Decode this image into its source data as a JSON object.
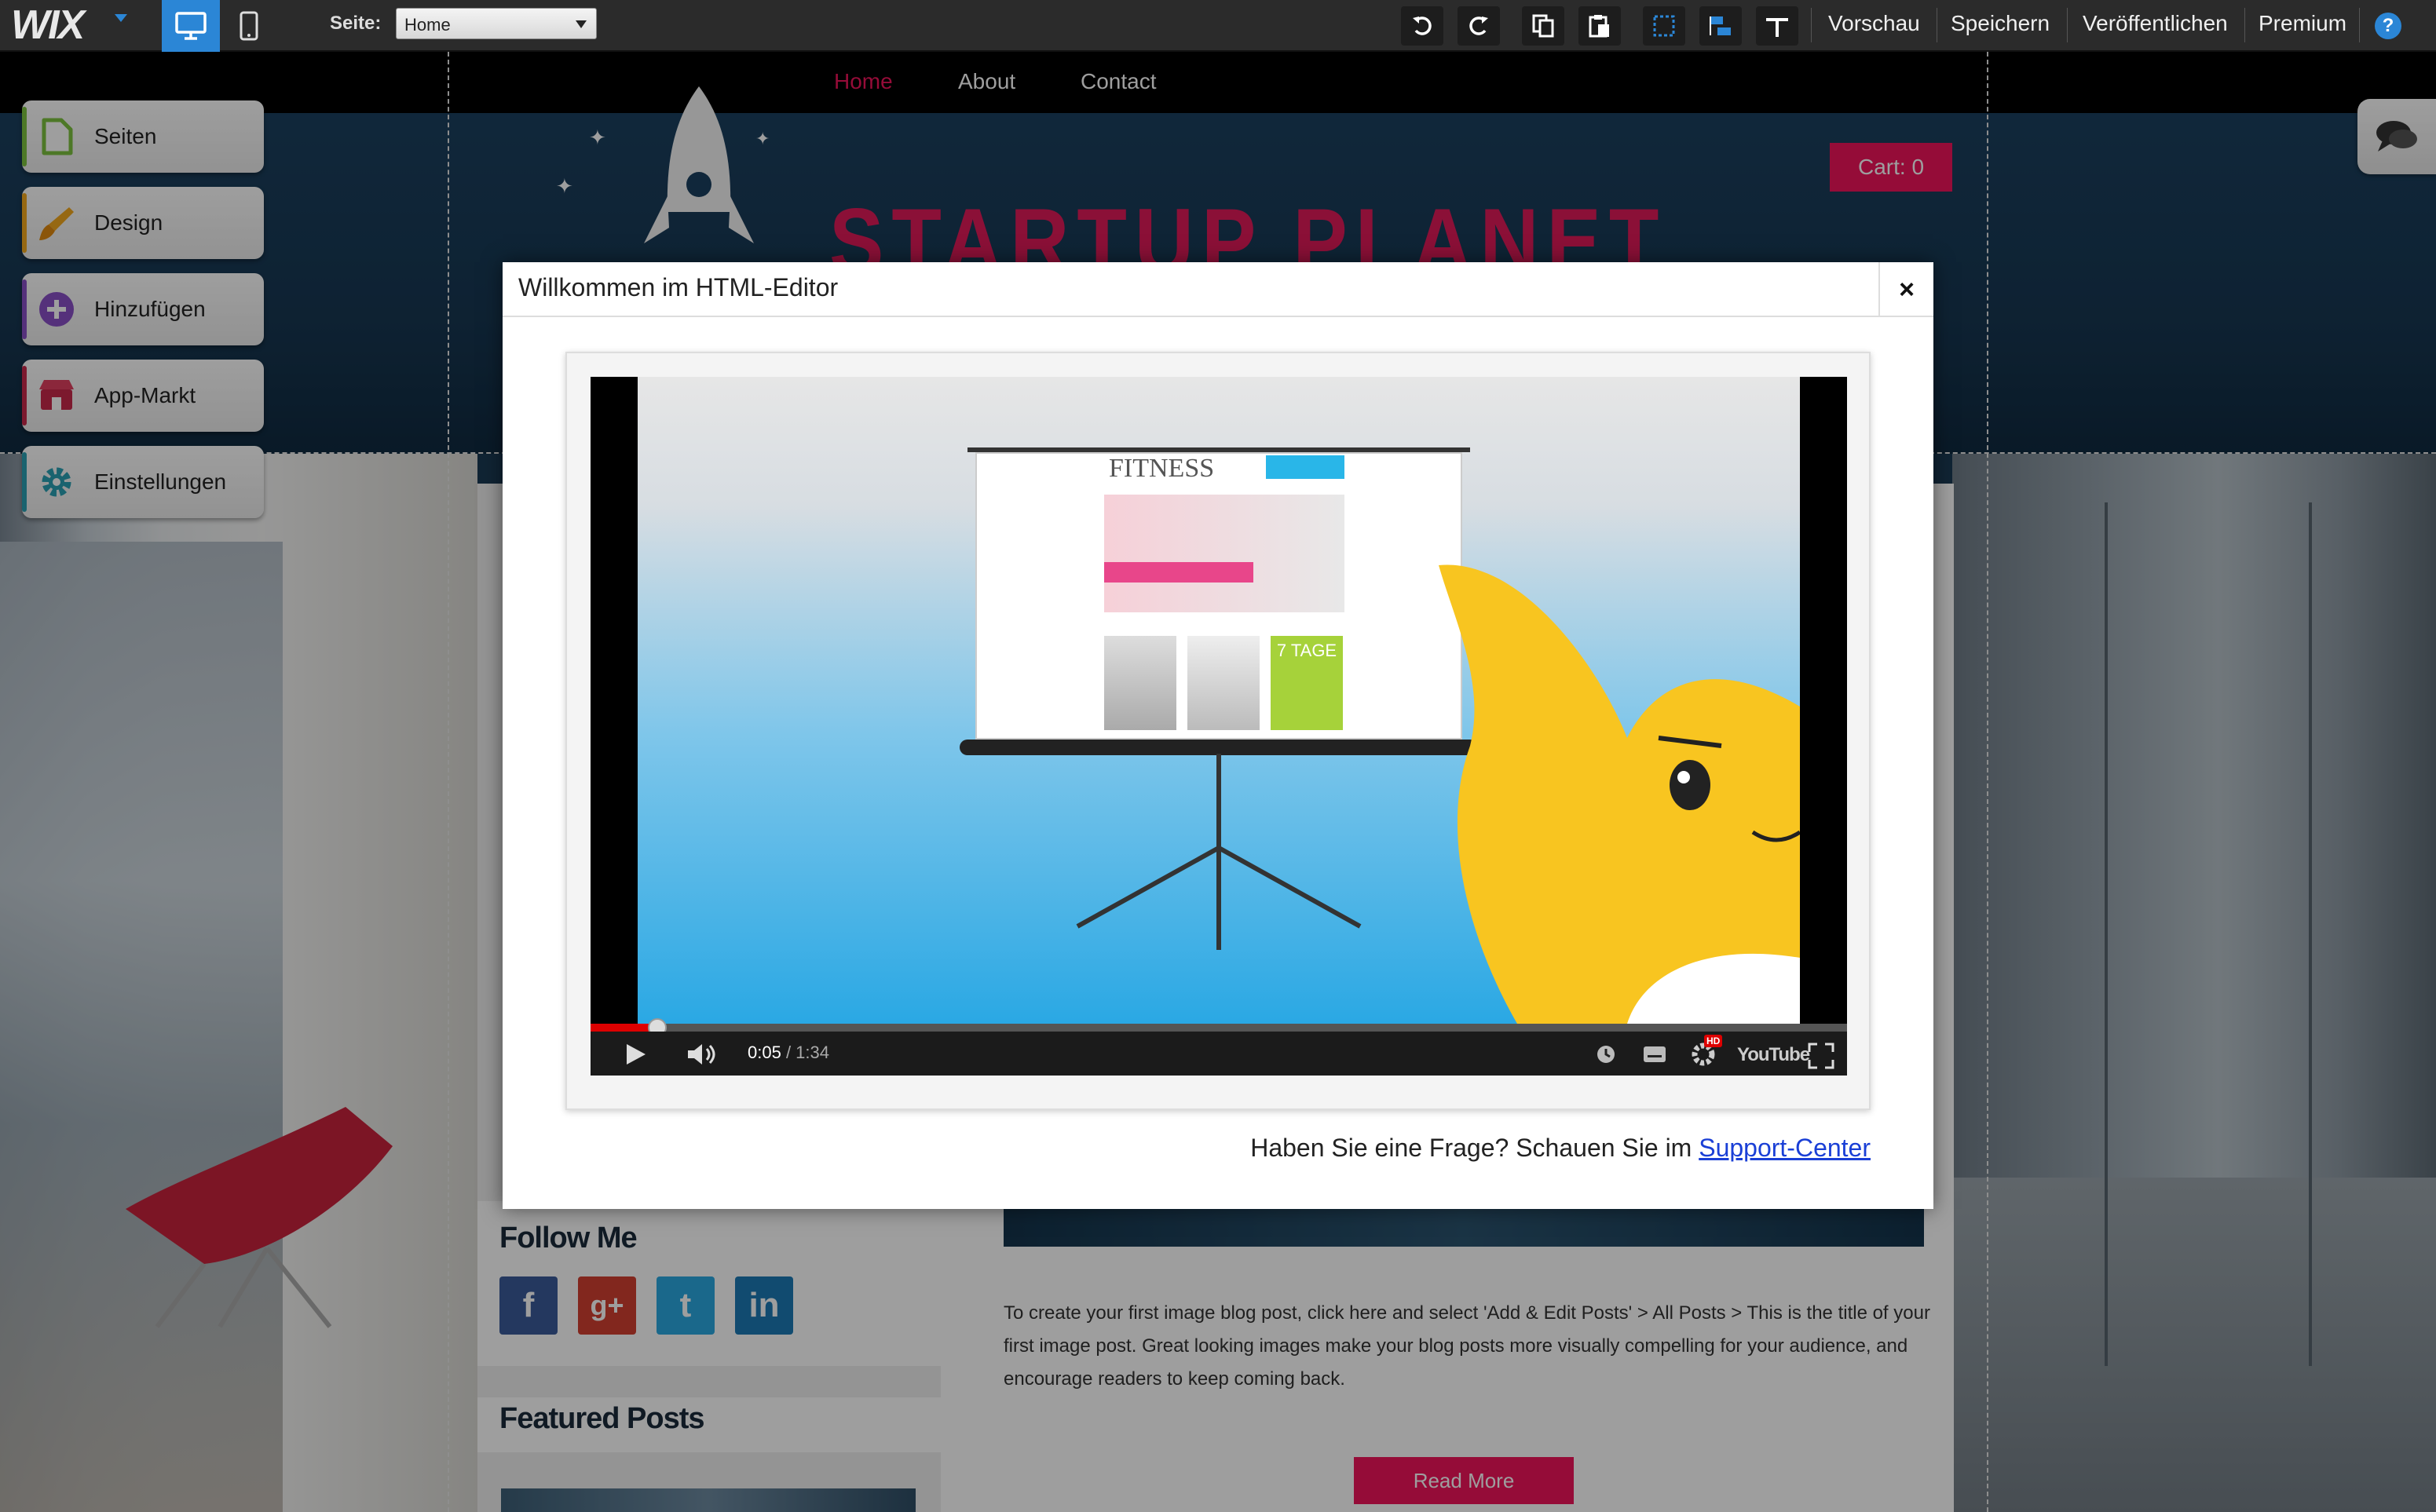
{
  "toolbar": {
    "logo": "WIX",
    "page_label": "Seite:",
    "page_value": "Home",
    "menu": [
      "Vorschau",
      "Speichern",
      "Veröffentlichen",
      "Premium"
    ],
    "help": "?"
  },
  "site": {
    "nav": [
      "Home",
      "About",
      "Contact"
    ],
    "title": "STARTUP PLANET",
    "cart": "Cart: 0",
    "follow_title": "Follow Me",
    "social": [
      "f",
      "g+",
      "t",
      "in"
    ],
    "featured_title": "Featured Posts",
    "post_text": "To create your first image blog post, click here and select 'Add & Edit Posts' > All Posts > This is the title of your first image post.  Great looking images make your blog posts more visually compelling for your audience, and encourage readers to keep coming back.",
    "read_more": "Read More"
  },
  "panel": {
    "items": [
      {
        "label": "Seiten",
        "icon": "page-icon",
        "color": "#7cc240"
      },
      {
        "label": "Design",
        "icon": "brush-icon",
        "color": "#f2a81d"
      },
      {
        "label": "Hinzufügen",
        "icon": "plus-icon",
        "color": "#8a4fc7"
      },
      {
        "label": "App-Markt",
        "icon": "store-icon",
        "color": "#c8294b"
      },
      {
        "label": "Einstellungen",
        "icon": "gear-icon",
        "color": "#2aa1b3"
      }
    ]
  },
  "modal": {
    "title": "Willkommen im HTML-Editor",
    "close": "×",
    "video": {
      "current": "0:05",
      "duration": "/ 1:34",
      "progress": 0.053,
      "screen_heading": "FITNESS",
      "screen_badge": "7 TAGE",
      "hd_badge": "HD",
      "youtube": "YouTube"
    },
    "support_prefix": "Haben Sie eine Frage? Schauen Sie im ",
    "support_link": "Support-Center"
  },
  "colors": {
    "accent": "#f0145b",
    "editor_blue": "#2b86d6",
    "toolbar": "#2b2b2b"
  }
}
